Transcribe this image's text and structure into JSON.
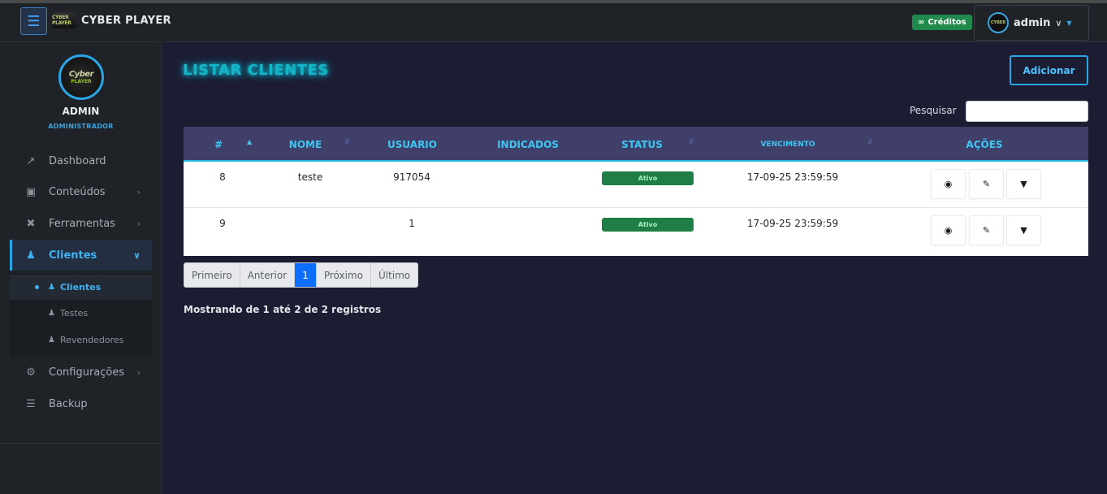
{
  "topbar": {
    "brand_logo_text": "CYBER PLAYER",
    "brand_name": "CYBER PLAYER",
    "credits_label": "Créditos",
    "credits_icon": "infinity-icon",
    "user_name": "admin"
  },
  "sidebar": {
    "avatar_line1": "Cyber",
    "avatar_line2": "PLAYER",
    "user_name": "ADMIN",
    "user_role": "ADMINISTRADOR",
    "nav": [
      {
        "label": "Dashboard",
        "icon": "chart-line-icon"
      },
      {
        "label": "Conteúdos",
        "icon": "boxes-icon"
      },
      {
        "label": "Ferramentas",
        "icon": "tools-icon"
      },
      {
        "label": "Clientes",
        "icon": "users-icon"
      },
      {
        "label": "Configurações",
        "icon": "cogs-icon"
      },
      {
        "label": "Backup",
        "icon": "database-icon"
      }
    ],
    "subnav": [
      {
        "label": "Clientes",
        "icon": "user-check-icon"
      },
      {
        "label": "Testes",
        "icon": "user-clock-icon"
      },
      {
        "label": "Revendedores",
        "icon": "user-tie-icon"
      }
    ]
  },
  "main": {
    "title": "LISTAR CLIENTES",
    "add_label": "Adicionar",
    "search_label": "Pesquisar",
    "search_value": "",
    "columns": [
      "#",
      "NOME",
      "USUARIO",
      "INDICADOS",
      "STATUS",
      "VENCIMENTO",
      "AÇÕES"
    ],
    "rows": [
      {
        "id": "8",
        "nome": "teste",
        "usuario": "917054",
        "indicados": "",
        "status": "Ativo",
        "vencimento": "17-09-25 23:59:59"
      },
      {
        "id": "9",
        "nome": "",
        "usuario": "1",
        "indicados": "",
        "status": "Ativo",
        "vencimento": "17-09-25 23:59:59"
      }
    ],
    "actions": [
      "eye-icon",
      "edit-icon",
      "caret-down-icon"
    ],
    "pagination": [
      "Primeiro",
      "Anterior",
      "1",
      "Próximo",
      "Último"
    ],
    "info": "Mostrando de 1 até 2 de 2 registros"
  },
  "colors": {
    "accent": "#2aa5e8",
    "title_glow": "#14b5c7",
    "status_active": "#1e7e45",
    "credits": "#1f8a4c",
    "table_header": "#3f3f6a"
  }
}
